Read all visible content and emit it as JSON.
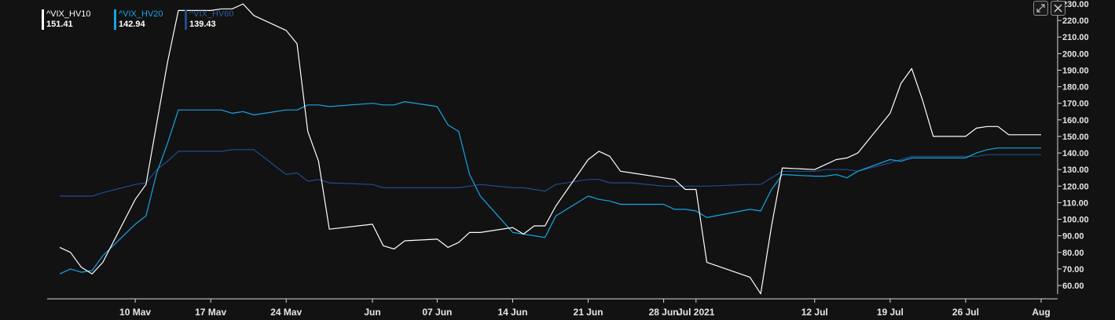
{
  "legend": [
    {
      "name": "^VIX_HV10",
      "value": "151.41",
      "color": "#ffffff"
    },
    {
      "name": "^VIX_HV20",
      "value": "142.94",
      "color": "#17a4e3"
    },
    {
      "name": "^VIX_HV60",
      "value": "139.43",
      "color": "#1f4e8c"
    }
  ],
  "toolbar": {
    "expand_icon": "expand-icon",
    "close_icon": "close-icon"
  },
  "chart_data": {
    "type": "line",
    "x_tick_labels": [
      "10 Mav",
      "17 Mav",
      "24 Mav",
      "Jun",
      "07 Jun",
      "14 Jun",
      "21 Jun",
      "28 Jun",
      "Jul 2021",
      "12 Jul",
      "19 Jul",
      "26 Jul",
      "Aug"
    ],
    "y_tick_labels": [
      "60.00",
      "70.00",
      "80.00",
      "90.00",
      "100.00",
      "110.00",
      "120.00",
      "130.00",
      "140.00",
      "150.00",
      "160.00",
      "170.00",
      "180.00",
      "190.00",
      "200.00",
      "210.00",
      "220.00",
      "230.00"
    ],
    "ylim": [
      55,
      232
    ],
    "grid": false,
    "legend_position": "top-left",
    "y_axis_position": "right",
    "x": [
      "2021-05-03",
      "2021-05-04",
      "2021-05-05",
      "2021-05-06",
      "2021-05-07",
      "2021-05-10",
      "2021-05-11",
      "2021-05-12",
      "2021-05-13",
      "2021-05-14",
      "2021-05-17",
      "2021-05-18",
      "2021-05-19",
      "2021-05-20",
      "2021-05-21",
      "2021-05-24",
      "2021-05-25",
      "2021-05-26",
      "2021-05-27",
      "2021-05-28",
      "2021-06-01",
      "2021-06-02",
      "2021-06-03",
      "2021-06-04",
      "2021-06-07",
      "2021-06-08",
      "2021-06-09",
      "2021-06-10",
      "2021-06-11",
      "2021-06-14",
      "2021-06-15",
      "2021-06-16",
      "2021-06-17",
      "2021-06-18",
      "2021-06-21",
      "2021-06-22",
      "2021-06-23",
      "2021-06-24",
      "2021-06-25",
      "2021-06-28",
      "2021-06-29",
      "2021-06-30",
      "2021-07-01",
      "2021-07-02",
      "2021-07-06",
      "2021-07-07",
      "2021-07-08",
      "2021-07-09",
      "2021-07-12",
      "2021-07-13",
      "2021-07-14",
      "2021-07-15",
      "2021-07-16",
      "2021-07-19",
      "2021-07-20",
      "2021-07-21",
      "2021-07-22",
      "2021-07-23",
      "2021-07-26",
      "2021-07-27",
      "2021-07-28",
      "2021-07-29",
      "2021-07-30",
      "2021-08-02"
    ],
    "series": [
      {
        "name": "^VIX_HV10",
        "color": "#ffffff",
        "values": [
          83,
          80,
          71,
          67,
          74,
          112,
          121,
          158,
          195,
          226,
          226,
          227,
          227,
          230,
          223,
          214,
          206,
          153,
          135,
          94,
          97,
          84,
          82,
          87,
          88,
          83,
          86,
          92,
          92,
          95,
          91,
          96,
          96,
          108,
          136,
          141,
          138,
          129,
          128,
          125,
          124,
          118,
          118,
          74,
          65,
          55,
          96,
          131,
          130,
          133,
          136,
          137,
          140,
          164,
          182,
          191,
          172,
          150,
          150,
          155,
          156,
          156,
          151,
          151
        ]
      },
      {
        "name": "^VIX_HV20",
        "color": "#17a4e3",
        "values": [
          67,
          70,
          68,
          69,
          78,
          97,
          102,
          128,
          146,
          166,
          166,
          166,
          164,
          165,
          163,
          166,
          166,
          169,
          169,
          168,
          170,
          169,
          169,
          171,
          168,
          157,
          153,
          127,
          114,
          92,
          91,
          90,
          89,
          102,
          114,
          112,
          111,
          109,
          109,
          109,
          106,
          106,
          105,
          101,
          106,
          105,
          118,
          127,
          126,
          126,
          127,
          125,
          129,
          136,
          135,
          137,
          137,
          137,
          137,
          140,
          142,
          143,
          143,
          143
        ]
      },
      {
        "name": "^VIX_HV60",
        "color": "#1f4e8c",
        "values": [
          114,
          114,
          114,
          114,
          116,
          121,
          122,
          130,
          135,
          141,
          141,
          141,
          142,
          142,
          142,
          127,
          128,
          123,
          124,
          122,
          121,
          119,
          119,
          119,
          119,
          119,
          119,
          120,
          121,
          119,
          119,
          118,
          117,
          121,
          124,
          124,
          122,
          122,
          122,
          120,
          120,
          120,
          120,
          120,
          121,
          121,
          125,
          129,
          129,
          130,
          130,
          130,
          129,
          134,
          136,
          138,
          138,
          138,
          138,
          138,
          139,
          139,
          139,
          139
        ]
      }
    ]
  }
}
